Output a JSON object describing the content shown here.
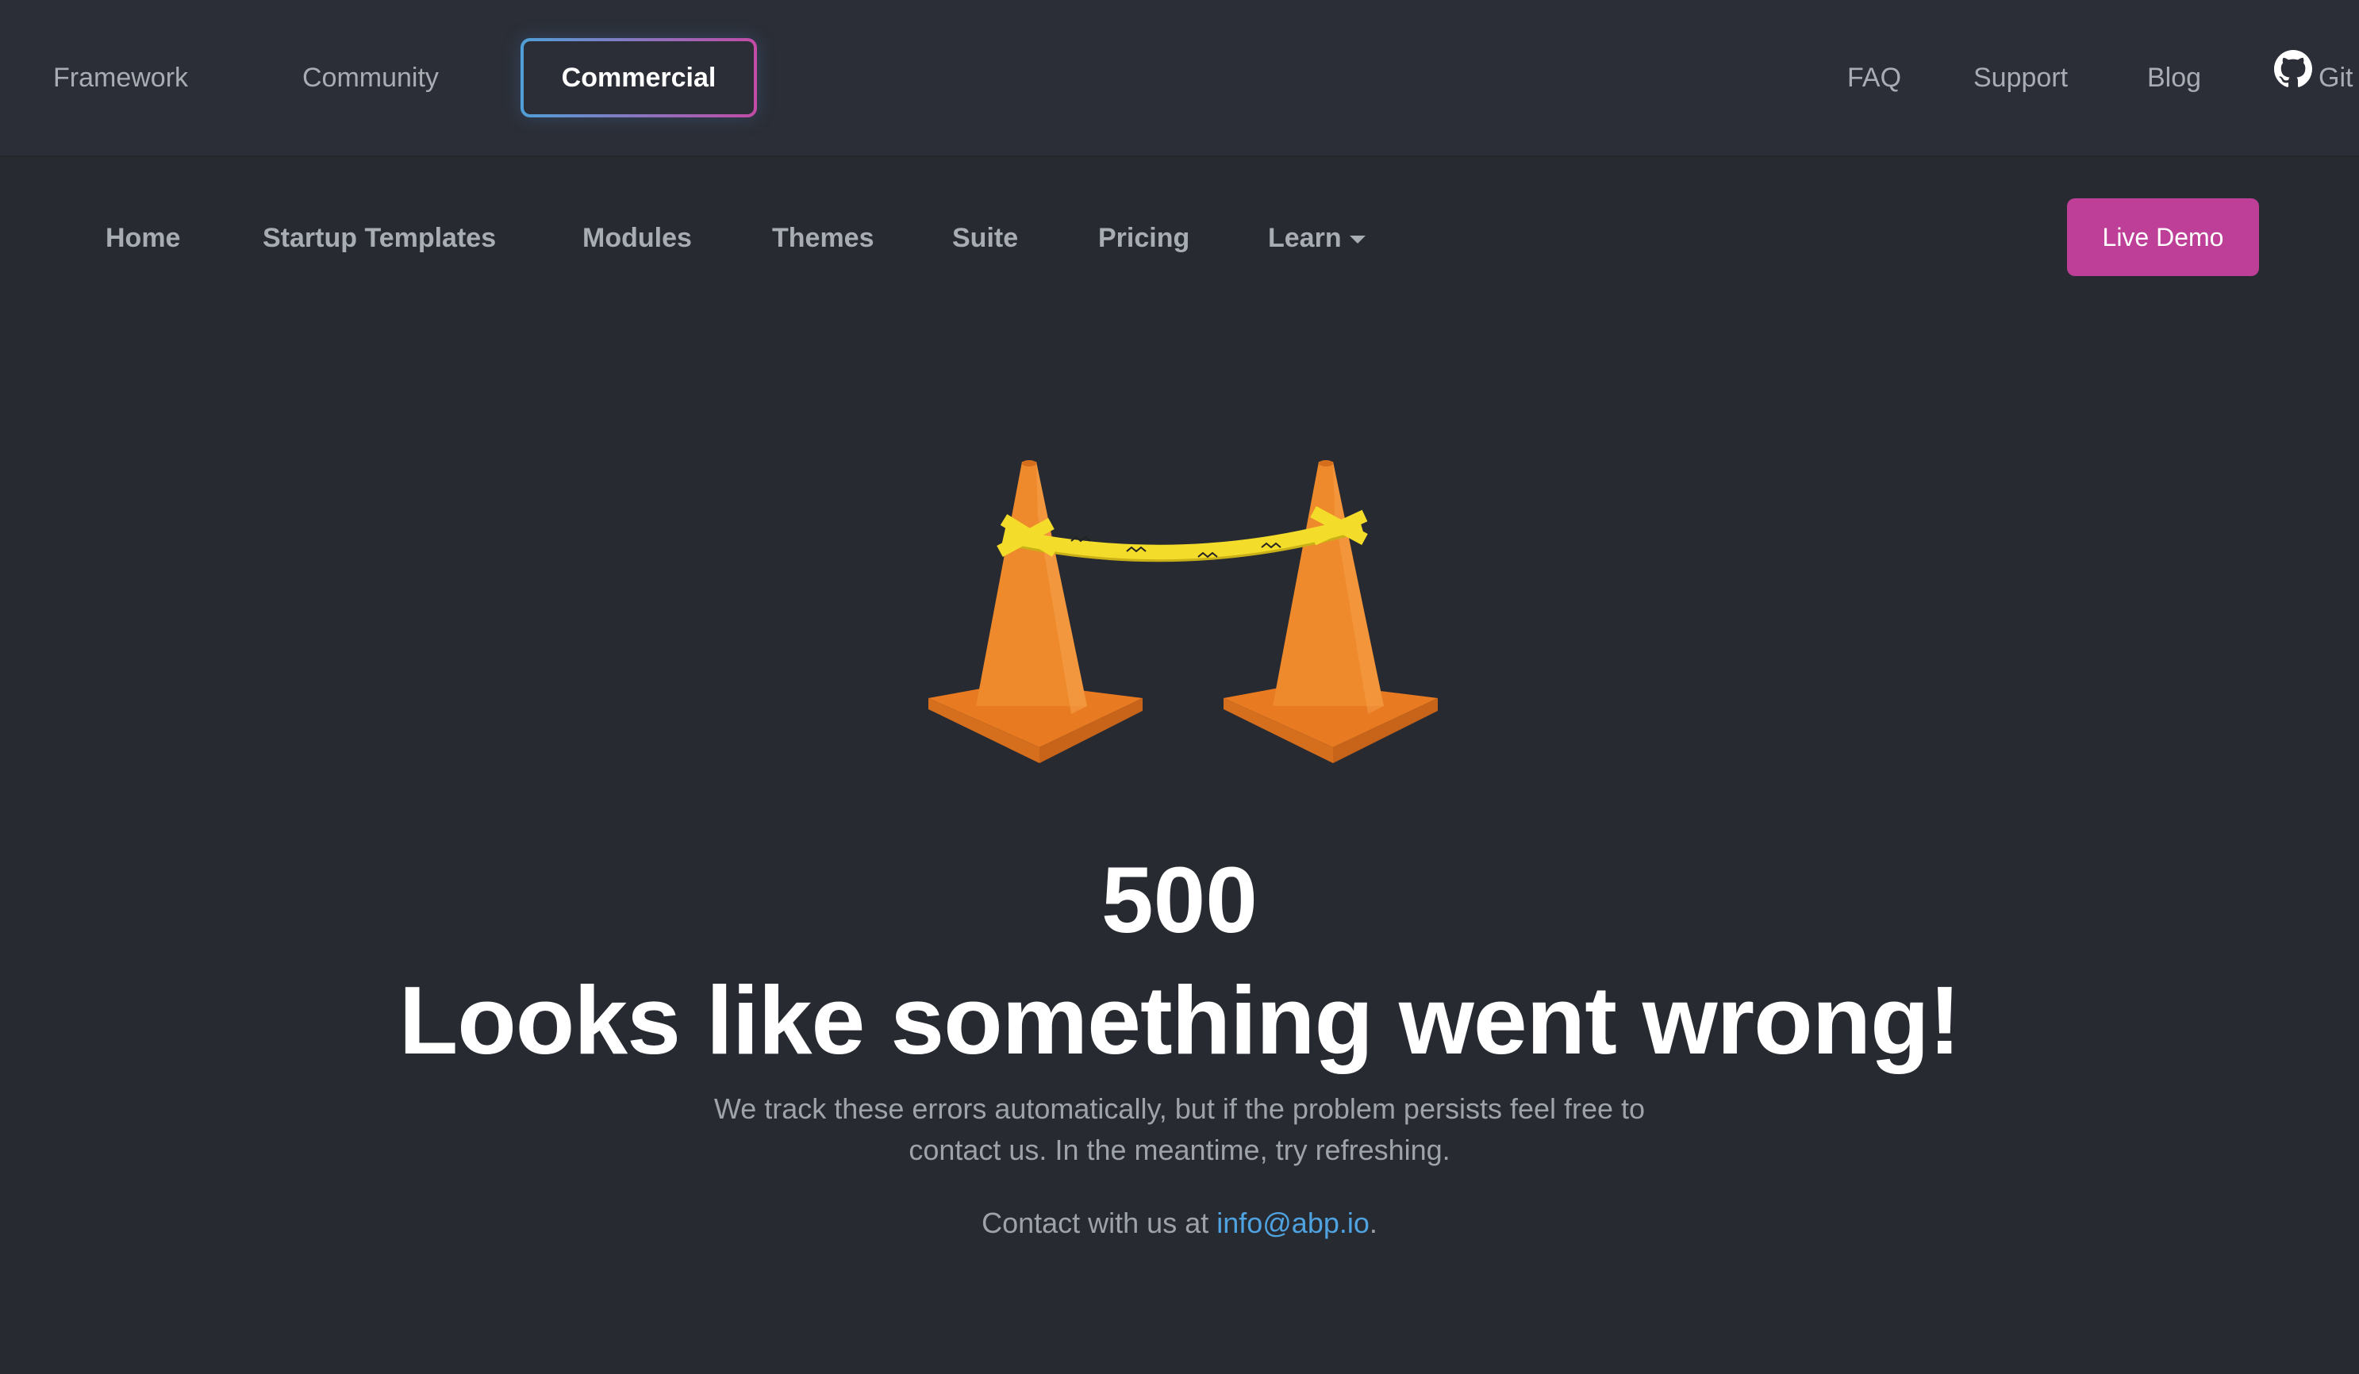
{
  "topnav": {
    "items": [
      "Framework",
      "Community",
      "Commercial"
    ],
    "active": "Commercial",
    "right": [
      "FAQ",
      "Support",
      "Blog",
      "Git"
    ]
  },
  "subnav": {
    "items": [
      "Home",
      "Startup Templates",
      "Modules",
      "Themes",
      "Suite",
      "Pricing",
      "Learn"
    ],
    "cta": "Live Demo"
  },
  "error": {
    "code": "500",
    "headline": "Looks like something went wrong!",
    "description": "We track these errors automatically, but if the problem persists feel free to contact us. In the meantime, try refreshing.",
    "contact_prefix": "Contact with us at ",
    "contact_email": "info@abp.io",
    "contact_suffix": "."
  },
  "colors": {
    "background": "#272a31",
    "cta": "#bd3f98",
    "link": "#4fa3e0",
    "cone": "#ee8a2b"
  }
}
